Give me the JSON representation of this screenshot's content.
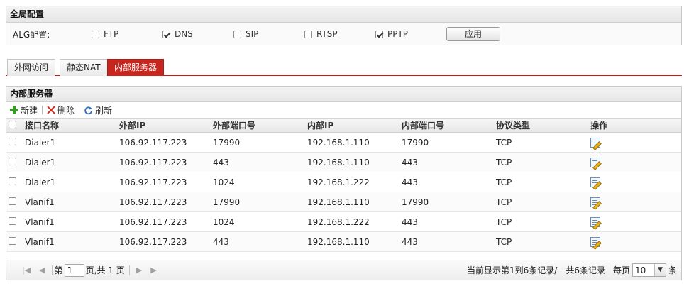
{
  "global": {
    "title": "全局配置",
    "alg_label": "ALG配置:",
    "options": [
      {
        "label": "FTP",
        "checked": false
      },
      {
        "label": "DNS",
        "checked": true
      },
      {
        "label": "SIP",
        "checked": false
      },
      {
        "label": "RTSP",
        "checked": false
      },
      {
        "label": "PPTP",
        "checked": true
      }
    ],
    "apply_label": "应用"
  },
  "tabs": [
    {
      "label": "外网访问",
      "active": false
    },
    {
      "label": "静态NAT",
      "active": false
    },
    {
      "label": "内部服务器",
      "active": true
    }
  ],
  "list": {
    "title": "内部服务器",
    "toolbar": {
      "new_label": "新建",
      "delete_label": "删除",
      "refresh_label": "刷新"
    },
    "columns": [
      "接口名称",
      "外部IP",
      "外部端口号",
      "内部IP",
      "内部端口号",
      "协议类型",
      "操作"
    ],
    "rows": [
      [
        "Dialer1",
        "106.92.117.223",
        "17990",
        "192.168.1.110",
        "17990",
        "TCP"
      ],
      [
        "Dialer1",
        "106.92.117.223",
        "443",
        "192.168.1.110",
        "443",
        "TCP"
      ],
      [
        "Dialer1",
        "106.92.117.223",
        "1024",
        "192.168.1.222",
        "443",
        "TCP"
      ],
      [
        "Vlanif1",
        "106.92.117.223",
        "17990",
        "192.168.1.110",
        "17990",
        "TCP"
      ],
      [
        "Vlanif1",
        "106.92.117.223",
        "1024",
        "192.168.1.222",
        "443",
        "TCP"
      ],
      [
        "Vlanif1",
        "106.92.117.223",
        "443",
        "192.168.1.110",
        "443",
        "TCP"
      ]
    ]
  },
  "pager": {
    "page_prefix": "第",
    "page_value": "1",
    "page_suffix": "页,共 1 页",
    "summary": "当前显示第1到6条记录/一共6条记录",
    "per_page_prefix": "每页",
    "per_page_value": "10",
    "per_page_suffix": "条"
  },
  "colors": {
    "accent": "#c6261d"
  }
}
